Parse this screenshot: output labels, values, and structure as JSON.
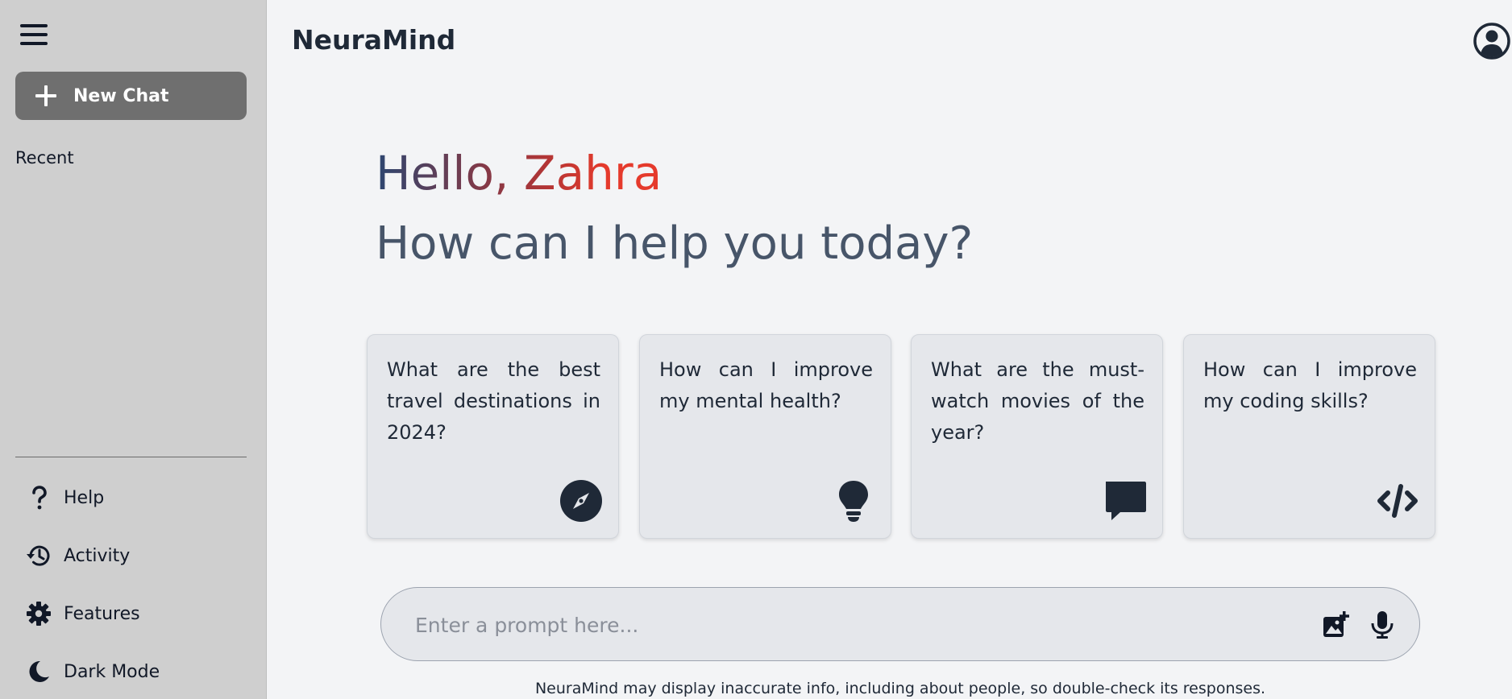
{
  "sidebar": {
    "menu_icon": "hamburger-menu-icon",
    "new_chat_label": "New Chat",
    "recent_label": "Recent",
    "items": [
      {
        "label": "Help",
        "icon": "question-icon"
      },
      {
        "label": "Activity",
        "icon": "history-icon"
      },
      {
        "label": "Features",
        "icon": "gear-icon"
      },
      {
        "label": "Dark Mode",
        "icon": "moon-icon"
      }
    ]
  },
  "header": {
    "brand": "NeuraMind",
    "avatar_icon": "user-circle-icon"
  },
  "hero": {
    "greeting": "Hello, Zahra",
    "subtitle": "How can I help you today?"
  },
  "cards": [
    {
      "text": "What are the best travel destinations in 2024?",
      "icon": "compass-icon"
    },
    {
      "text": "How can I improve my mental health?",
      "icon": "lightbulb-icon"
    },
    {
      "text": "What are the must-watch movies of the year?",
      "icon": "message-icon"
    },
    {
      "text": "How can I improve my coding skills?",
      "icon": "code-icon"
    }
  ],
  "prompt": {
    "placeholder": "Enter a prompt here...",
    "value": "",
    "image_icon": "add-image-icon",
    "mic_icon": "microphone-icon"
  },
  "footer": {
    "disclaimer": "NeuraMind may display inaccurate info, including about people, so double-check its responses."
  },
  "colors": {
    "sidebar_bg": "#cfcfcf",
    "main_bg": "#f3f4f6",
    "new_chat_bg": "#6f6f6f",
    "card_bg": "#e5e7eb",
    "greeting_gradient_start": "#2c4670",
    "greeting_gradient_end": "#e53a2c"
  }
}
